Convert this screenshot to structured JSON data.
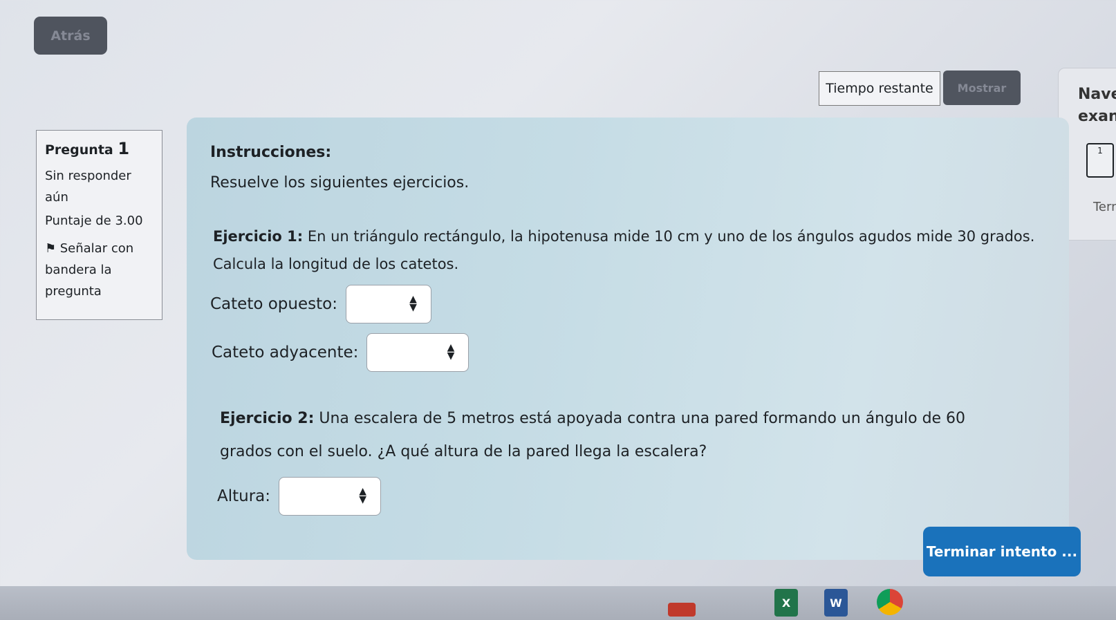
{
  "header": {
    "back_label": "Atrás"
  },
  "timer": {
    "label": "Tiempo restante",
    "show_label": "Mostrar"
  },
  "navigation": {
    "title": "Nave\nexan",
    "question_number": "1",
    "finish_label": "Tern"
  },
  "question_info": {
    "prefix": "Pregunta",
    "number": "1",
    "state": "Sin responder aún",
    "grade": "Puntaje de 3.00",
    "flag_label": "Señalar con bandera la pregunta"
  },
  "content": {
    "instructions_title": "Instrucciones:",
    "instructions_text": "Resuelve los siguientes ejercicios.",
    "ex1_label": "Ejercicio 1:",
    "ex1_text": " En un triángulo rectángulo, la hipotenusa mide 10 cm y uno de los ángulos agudos mide 30 grados. Calcula la longitud de los catetos.",
    "field_opuesto": "Cateto opuesto:",
    "field_adyacente": "Cateto adyacente:",
    "ex2_label": "Ejercicio 2:",
    "ex2_text": " Una escalera de 5 metros está apoyada contra una pared formando un ángulo de 60 grados con el suelo. ¿A qué altura de la pared llega la escalera?",
    "field_altura": "Altura:"
  },
  "footer": {
    "finish_attempt": "Terminar intento ..."
  },
  "taskbar": {
    "excel_letter": "X",
    "word_letter": "W"
  },
  "icons": {
    "flag": "flag-icon",
    "spinner": "spinner-icon"
  },
  "colors": {
    "primary": "#1a72bb",
    "secondary_button": "#50555f",
    "content_bg": "#c5dce5"
  }
}
